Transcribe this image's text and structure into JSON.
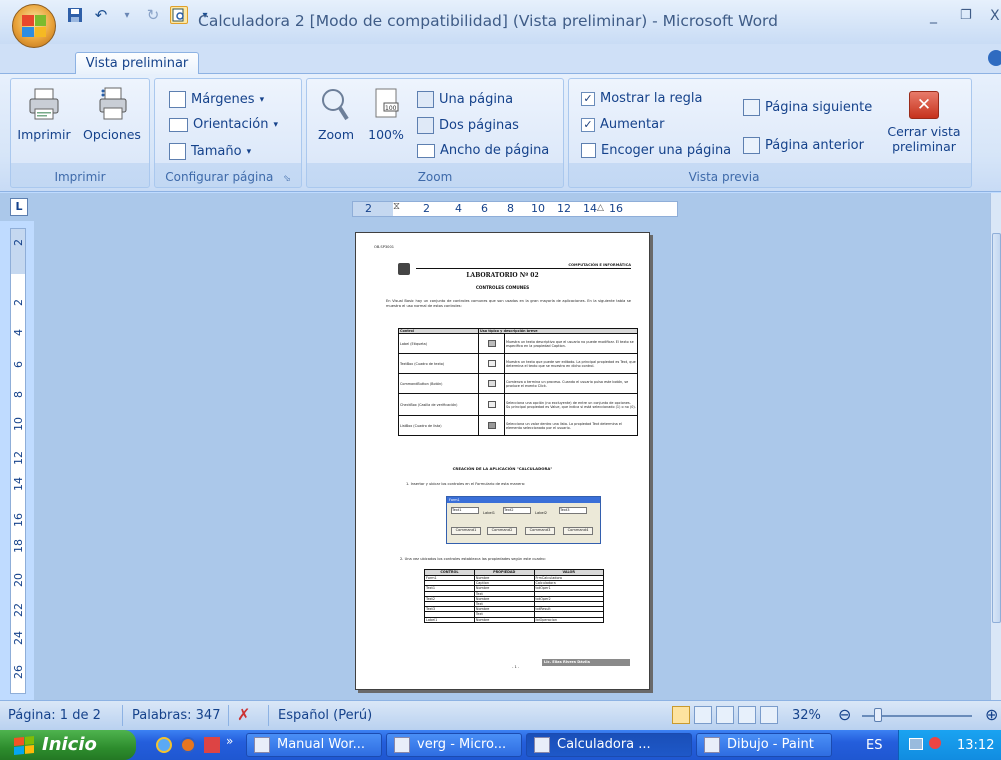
{
  "window": {
    "title": "Calculadora 2 [Modo de compatibilidad] (Vista preliminar) - Microsoft Word",
    "minimize": "_",
    "restore": "❐",
    "close": "X"
  },
  "ribbon": {
    "active_tab": "Vista preliminar",
    "groups": {
      "imprimir": {
        "label": "Imprimir",
        "print": "Imprimir",
        "options": "Opciones"
      },
      "configurar": {
        "label": "Configurar página",
        "margins": "Márgenes",
        "orientation": "Orientación",
        "size": "Tamaño"
      },
      "zoom": {
        "label": "Zoom",
        "zoom": "Zoom",
        "percent": "100%",
        "one_page": "Una página",
        "two_pages": "Dos páginas",
        "page_width": "Ancho de página"
      },
      "vista_previa": {
        "label": "Vista previa",
        "show_ruler": "Mostrar la regla",
        "magnify": "Aumentar",
        "shrink": "Encoger una página",
        "next_page": "Página siguiente",
        "prev_page": "Página anterior",
        "close_line1": "Cerrar vista",
        "close_line2": "preliminar"
      }
    }
  },
  "ruler": {
    "h_numbers": [
      "2",
      "2",
      "4",
      "6",
      "8",
      "10",
      "12",
      "14",
      "16"
    ],
    "v_numbers": [
      "2",
      "2",
      "4",
      "6",
      "8",
      "10",
      "12",
      "14",
      "16",
      "18",
      "20",
      "22",
      "24",
      "26"
    ]
  },
  "document": {
    "header_left": "OB.SP3001",
    "header_right": "COMPUTACIÓN E INFORMÁTICA",
    "title": "LABORATORIO Nº 02",
    "subtitle": "CONTROLES COMUNES",
    "intro": "En Visual Basic hay un conjunto de controles comunes que son usados en la gran mayoría de aplicaciones. En la siguiente tabla se muestra el uso normal de estos controles:",
    "table1": {
      "headers": [
        "Control",
        "Uso típico y descripción breve"
      ],
      "rows": [
        [
          "Label (Etiqueta)",
          "Muestra un texto descriptivo que el usuario no puede modificar. El texto se especifica en la propiedad Caption."
        ],
        [
          "TextBox (Cuadro de texto)",
          "Muestra un texto que puede ser editado. La principal propiedad es Text, que determina el texto que se muestra en dicho control."
        ],
        [
          "CommandButton (Botón)",
          "Comienza o termina un proceso. Cuando el usuario pulsa este botón, se produce el evento Click."
        ],
        [
          "CheckBox (Casilla de verificación)",
          "Selecciona una opción (no excluyente) de entre un conjunto de opciones. Su principal propiedad es Value, que indica si está seleccionado (1) o no (0)."
        ],
        [
          "ListBox (Cuadro de lista)",
          "Selecciona un valor dentro una lista. La propiedad Text determina el elemento seleccionado por el usuario."
        ]
      ]
    },
    "section_title": "CREACIÓN DE LA APLICACIÓN \"CALCULADORA\"",
    "step1": "1.  Insertar y ubicar los controles en el Formulario de esta manera:",
    "form_title": "Form1",
    "form_controls": [
      "Text1",
      "Label1",
      "Text2",
      "Label2",
      "Text3",
      "Command1",
      "Command2",
      "Command3",
      "Command4"
    ],
    "step2": "2.  Una vez ubicados los controles establezca las propiedades según este cuadro:",
    "table2": {
      "headers": [
        "CONTROL",
        "PROPIEDAD",
        "VALOR"
      ],
      "rows": [
        [
          "Form1",
          "Nombre",
          "FrmCalculadora"
        ],
        [
          "",
          "Caption",
          "Calculadora"
        ],
        [
          "Text1",
          "Nombre",
          "txtOper1"
        ],
        [
          "",
          "Text",
          ""
        ],
        [
          "Text2",
          "Nombre",
          "txtOper2"
        ],
        [
          "",
          "Text",
          ""
        ],
        [
          "Text3",
          "Nombre",
          "txtResult"
        ],
        [
          "",
          "Text",
          ""
        ],
        [
          "Label1",
          "Nombre",
          "lblOperacion"
        ]
      ]
    },
    "page_number": "- 1 -",
    "author": "Lic. Elias Rivera Dávila"
  },
  "statusbar": {
    "page": "Página: 1 de 2",
    "words": "Palabras: 347",
    "language": "Español (Perú)",
    "zoom": "32%"
  },
  "taskbar": {
    "start": "Inicio",
    "tasks": [
      "Manual Wor...",
      "verg - Micro...",
      "Calculadora ...",
      "Dibujo - Paint"
    ],
    "lang": "ES",
    "clock": "13:12"
  }
}
